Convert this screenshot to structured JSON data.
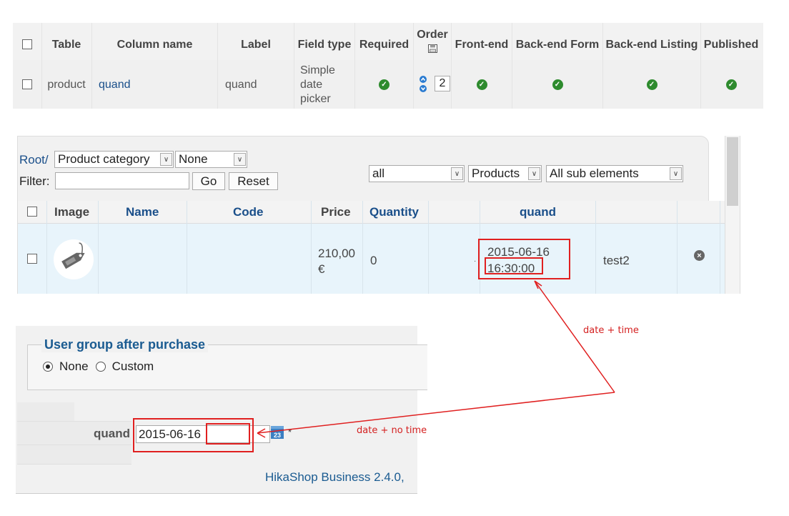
{
  "fields_table": {
    "headers": {
      "table": "Table",
      "column_name": "Column name",
      "label": "Label",
      "field_type": "Field type",
      "required": "Required",
      "order": "Order",
      "front_end": "Front-end",
      "back_end_form": "Back-end Form",
      "back_end_listing": "Back-end Listing",
      "published": "Published"
    },
    "row": {
      "table": "product",
      "column_name": "quand",
      "label": "quand",
      "field_type_line1": "Simple",
      "field_type_line2": "date",
      "field_type_line3": "picker",
      "order_value": "2"
    },
    "status_color": "#2e8b2e"
  },
  "products_list": {
    "root_link": "Root/",
    "category_select": "Product category",
    "none_select": "None",
    "filter_label": "Filter:",
    "filter_value": "",
    "go_button": "Go",
    "reset_button": "Reset",
    "all_select": "all",
    "type_select": "Products",
    "sub_select": "All sub elements",
    "headers": {
      "image": "Image",
      "name": "Name",
      "code": "Code",
      "price": "Price",
      "quantity": "Quantity",
      "quand": "quand"
    },
    "row": {
      "price_line1": "210,00",
      "price_line2": "€",
      "quantity": "0",
      "quand_date": "2015-06-16",
      "quand_time": "16:30:00",
      "extra": "test2"
    }
  },
  "product_form": {
    "group_legend": "User group after purchase",
    "option_none": "None",
    "option_custom": "Custom",
    "selected_option": "None",
    "quand_label": "quand",
    "quand_value": "2015-06-16",
    "required_mark": "*",
    "footer": "HikaShop Business 2.4.0,"
  },
  "annotations": {
    "date_time": "date + time",
    "date_no_time": "date +   no time",
    "color": "#e02020"
  }
}
